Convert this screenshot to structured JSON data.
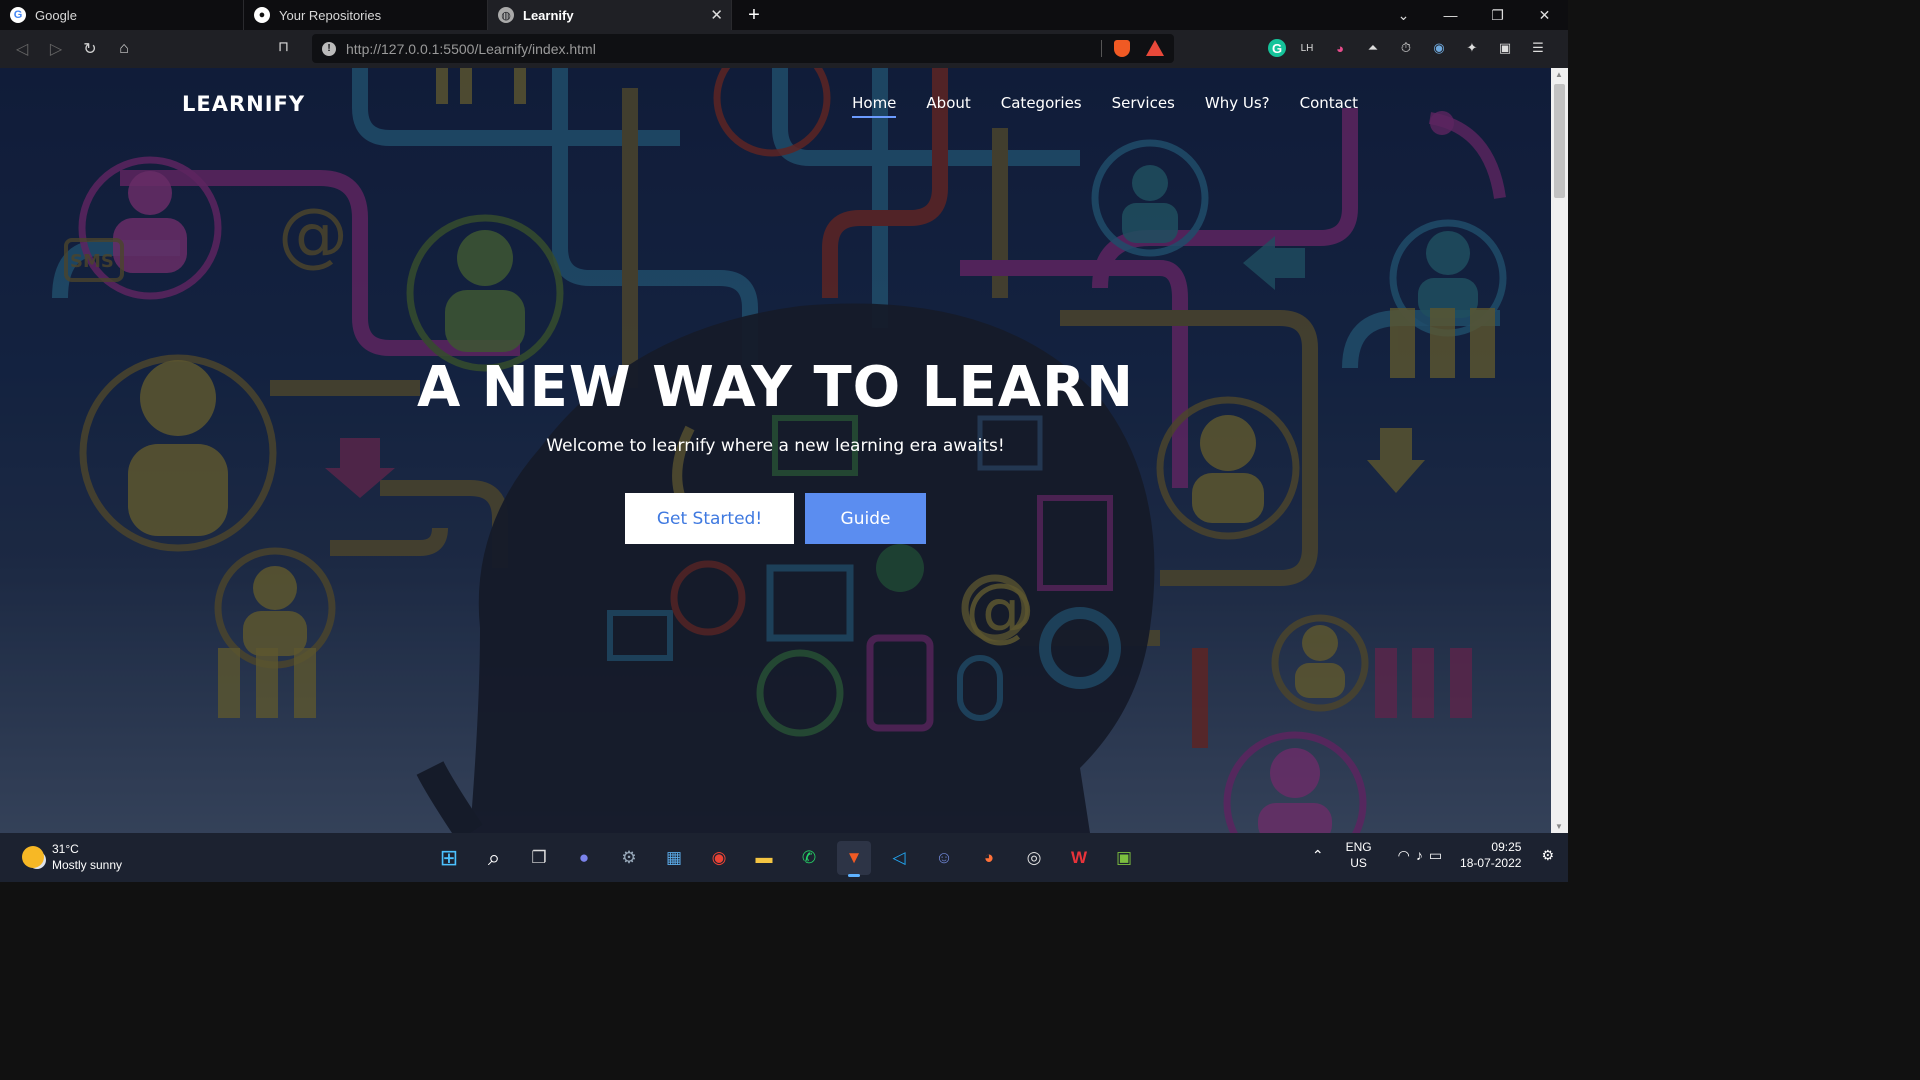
{
  "tabs": [
    {
      "title": "Google",
      "icon": "google-icon",
      "color": "#ffffff"
    },
    {
      "title": "Your Repositories",
      "icon": "github-icon",
      "color": "#ffffff"
    },
    {
      "title": "Learnify",
      "icon": "globe-icon",
      "color": "#ffffff",
      "active": true
    }
  ],
  "toolbar": {
    "url": "http://127.0.0.1:5500/Learnify/index.html"
  },
  "page": {
    "logo": "LEARNIFY",
    "nav": [
      "Home",
      "About",
      "Categories",
      "Services",
      "Why Us?",
      "Contact"
    ],
    "active_nav": "Home",
    "hero_title": "A NEW WAY TO LEARN",
    "hero_subtitle": "Welcome to learnify where a new learning era awaits!",
    "btn_primary": "Get Started!",
    "btn_secondary": "Guide",
    "accent_color": "#5b8df0"
  },
  "taskbar": {
    "weather_temp": "31°C",
    "weather_desc": "Mostly sunny",
    "lang": "ENG",
    "region": "US",
    "time": "09:25",
    "date": "18-07-2022"
  }
}
